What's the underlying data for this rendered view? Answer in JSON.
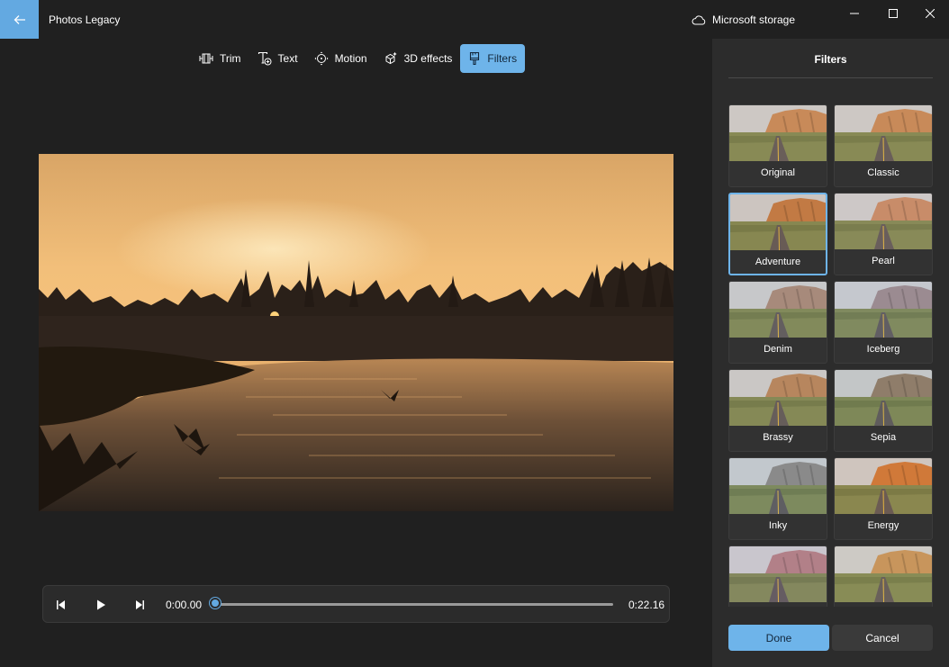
{
  "app": {
    "title": "Photos Legacy",
    "storage_label": "Microsoft storage"
  },
  "toolbar": {
    "tools": [
      {
        "label": "Trim",
        "icon": "trim-icon"
      },
      {
        "label": "Text",
        "icon": "text-icon"
      },
      {
        "label": "Motion",
        "icon": "motion-icon"
      },
      {
        "label": "3D effects",
        "icon": "3d-effects-icon"
      },
      {
        "label": "Filters",
        "icon": "filters-icon",
        "active": true
      }
    ]
  },
  "player": {
    "time_current": "0:00.00",
    "time_total": "0:22.16",
    "progress": 0.0
  },
  "filters_panel": {
    "title": "Filters",
    "selected": "Adventure",
    "items": [
      {
        "label": "Original",
        "tone": "#c98a5a"
      },
      {
        "label": "Classic",
        "tone": "#c98a5a"
      },
      {
        "label": "Adventure",
        "tone": "#c27a45"
      },
      {
        "label": "Pearl",
        "tone": "#c98d6a"
      },
      {
        "label": "Denim",
        "tone": "#a88a7c"
      },
      {
        "label": "Iceberg",
        "tone": "#9c8c92"
      },
      {
        "label": "Brassy",
        "tone": "#b8875e"
      },
      {
        "label": "Sepia",
        "tone": "#8f7d6b"
      },
      {
        "label": "Inky",
        "tone": "#8a8a8a"
      },
      {
        "label": "Energy",
        "tone": "#d0793a"
      },
      {
        "label": "",
        "tone": "#b28088"
      },
      {
        "label": "",
        "tone": "#c9955c"
      }
    ],
    "done_label": "Done",
    "cancel_label": "Cancel"
  },
  "colors": {
    "accent": "#6eb4ea",
    "background": "#202020",
    "panel": "#2c2c2c"
  }
}
